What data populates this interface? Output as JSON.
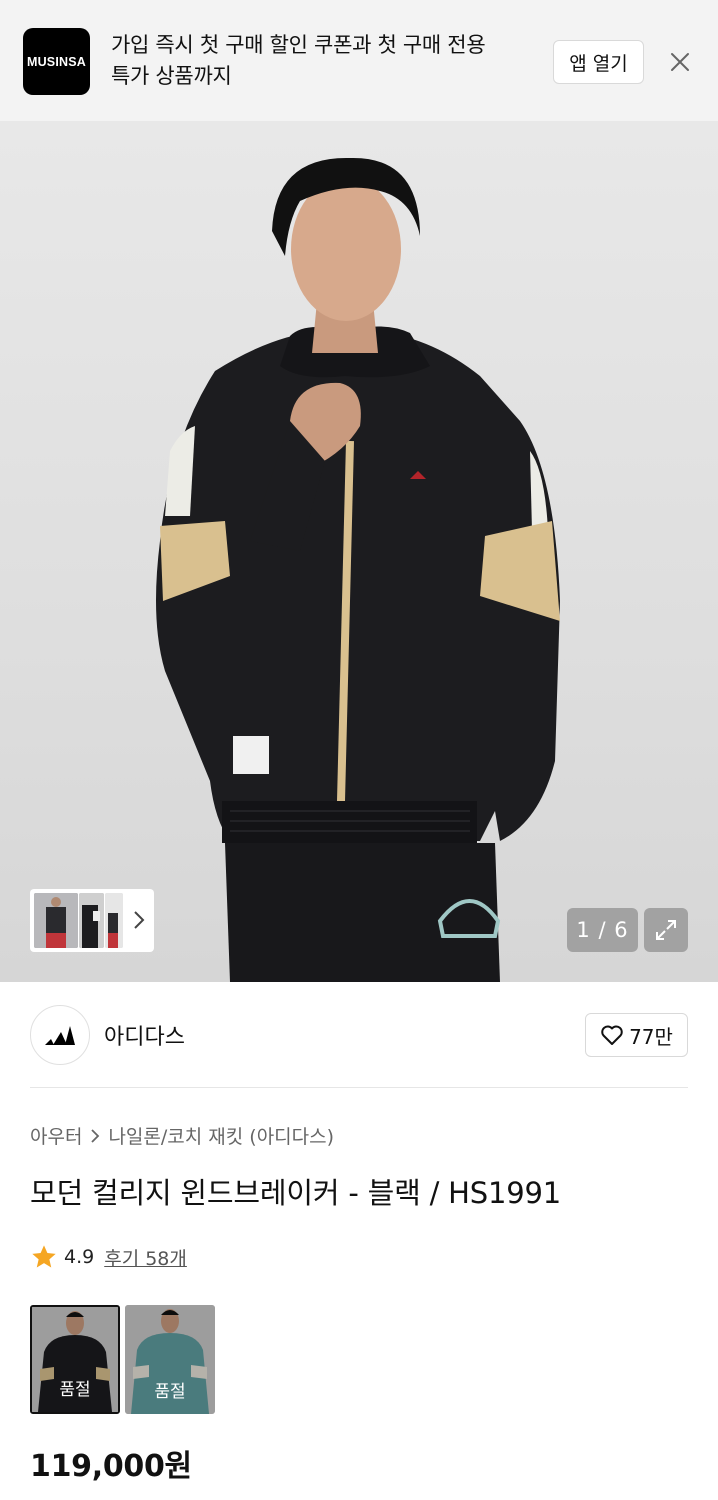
{
  "banner": {
    "logo_text": "MUSINSA",
    "message_line1": "가입 즉시 첫 구매 할인 쿠폰과 첫 구매 전용",
    "message_line2": "특가 상품까지",
    "open_app_label": "앱 열기",
    "close_icon": "close-icon"
  },
  "gallery": {
    "counter": "1 / 6",
    "expand_icon": "expand-icon",
    "thumbnails_icon": "chevron-right-icon"
  },
  "brand": {
    "name": "아디다스",
    "logo_icon": "adidas-logo",
    "like_count": "77만",
    "like_icon": "heart-icon"
  },
  "product": {
    "breadcrumb": [
      "아우터",
      "나일론/코치 재킷 (아디다스)"
    ],
    "title": "모던 컬리지 윈드브레이커 - 블랙 / HS1991",
    "rating": "4.9",
    "reviews_label": "후기 58개",
    "variants": [
      {
        "label": "품절",
        "color": "#1c1c1f"
      },
      {
        "label": "품절",
        "color": "#5f9ea0"
      }
    ],
    "price": "119,000원"
  },
  "colors": {
    "star": "#f5a623",
    "jacket": "#1c1c1f",
    "accent": "#d9c08f"
  }
}
